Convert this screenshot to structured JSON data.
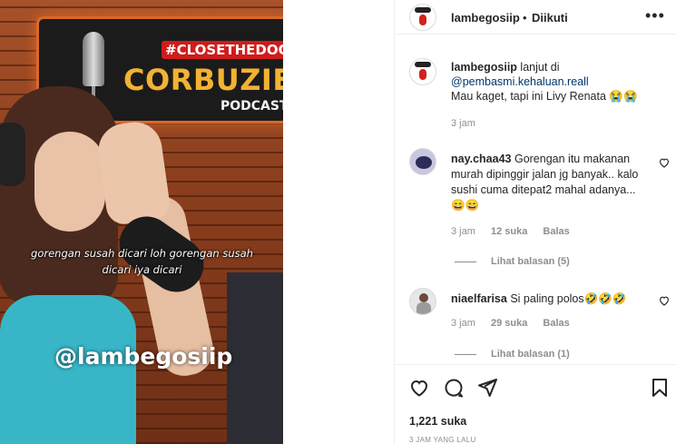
{
  "media": {
    "sign_tag": "#CLOSETHEDOOR",
    "sign_brand": "CORBUZIER",
    "sign_sub": "PODCAST",
    "subtitle_line1": "gorengan susah dicari loh gorengan susah",
    "subtitle_line2": "dicari iya dicari",
    "watermark": "@lambegosiip"
  },
  "header": {
    "username": "lambegosiip",
    "separator": "•",
    "follow_status": "Diikuti",
    "more": "•••"
  },
  "caption": {
    "username": "lambegosiip",
    "intro": "lanjut di",
    "mention": "@pembasmi.kehaluan.reall",
    "text": "Mau kaget, tapi ini Livy Renata 😭😭",
    "time": "3 jam"
  },
  "comments": [
    {
      "username": "nay.chaa43",
      "text": "Gorengan itu makanan murah dipinggir jalan jg banyak.. kalo sushi cuma ditepat2 mahal adanya...😄😄",
      "time": "3 jam",
      "likes": "12 suka",
      "reply": "Balas",
      "view_replies": "Lihat balasan (5)"
    },
    {
      "username": "niaelfarisa",
      "text": "Si paling polos🤣🤣🤣",
      "time": "3 jam",
      "likes": "29 suka",
      "reply": "Balas",
      "view_replies": "Lihat balasan (1)"
    }
  ],
  "footer": {
    "likes": "1,221 suka",
    "posted": "3 JAM YANG LALU"
  },
  "icons": {
    "like": "heart-icon",
    "comment": "comment-icon",
    "share": "paper-plane-icon",
    "save": "bookmark-icon"
  }
}
